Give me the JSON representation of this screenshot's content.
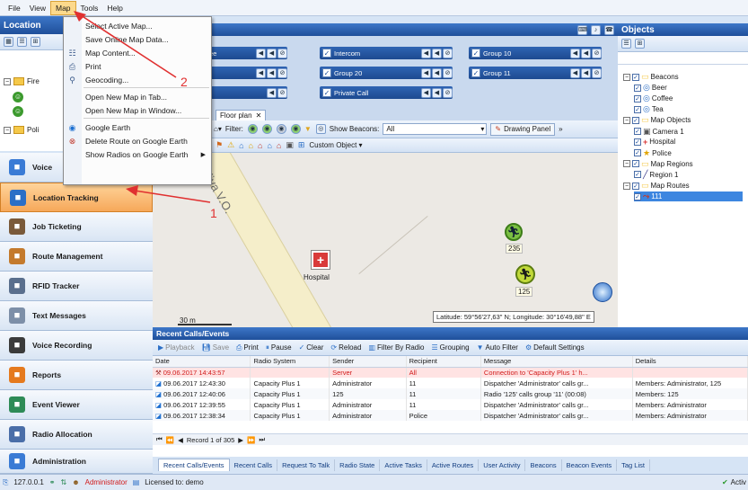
{
  "menubar": [
    "File",
    "View",
    "Map",
    "Tools",
    "Help"
  ],
  "map_menu": [
    {
      "label": "Select Active Map...",
      "icon": ""
    },
    {
      "label": "Save Online Map Data...",
      "icon": ""
    },
    {
      "label": "Map Content...",
      "icon": "list-icon"
    },
    {
      "label": "Print",
      "icon": "printer-icon"
    },
    {
      "label": "Geocoding...",
      "icon": "geocoding-icon"
    },
    {
      "label": "Open New Map in Tab...",
      "icon": ""
    },
    {
      "label": "Open New Map in Window...",
      "icon": ""
    },
    {
      "label": "Google Earth",
      "icon": "google-earth-icon"
    },
    {
      "label": "Delete Route on Google Earth",
      "icon": "delete-route-icon"
    },
    {
      "label": "Show Radios on Google Earth",
      "icon": ""
    }
  ],
  "left_panel": {
    "title": "Location",
    "tree": [
      "Fire",
      "Poli"
    ],
    "nav": [
      {
        "label": "Voice",
        "icon": "voice-dispatch-icon",
        "color": "#3a7bd5"
      },
      {
        "label": "Location Tracking",
        "icon": "location-tracking-icon",
        "color": "#2c6fc6",
        "selected": true
      },
      {
        "label": "Job Ticketing",
        "icon": "job-ticketing-icon",
        "color": "#7a5a3a"
      },
      {
        "label": "Route Management",
        "icon": "route-management-icon",
        "color": "#c47a2c"
      },
      {
        "label": "RFID Tracker",
        "icon": "rfid-icon",
        "color": "#5a6f8d"
      },
      {
        "label": "Text Messages",
        "icon": "text-messages-icon",
        "color": "#7d8fa8"
      },
      {
        "label": "Voice Recording",
        "icon": "voice-recording-icon",
        "color": "#3b3b3b"
      },
      {
        "label": "Reports",
        "icon": "reports-icon",
        "color": "#e57a1e"
      },
      {
        "label": "Event Viewer",
        "icon": "event-viewer-icon",
        "color": "#2e8b57"
      },
      {
        "label": "Radio Allocation",
        "icon": "radio-allocation-icon",
        "color": "#4a6ea8"
      },
      {
        "label": "Administration",
        "icon": "administration-icon",
        "color": "#3a7bd5"
      }
    ]
  },
  "annotations": {
    "arrow1": "1",
    "arrow2": "2"
  },
  "call_groups": {
    "col1": [
      "ee",
      "",
      ""
    ],
    "col2": [
      "Intercom",
      "Group 20",
      "Private Call"
    ],
    "col3": [
      "Group 10",
      "Group 11"
    ]
  },
  "map_tabs": [
    "Floor plan"
  ],
  "map_toolbar": {
    "filter_label": "Filter:",
    "show_beacons_label": "Show Beacons:",
    "show_beacons_value": "All",
    "drawing_panel": "Drawing Panel",
    "custom_object": "Custom Object"
  },
  "map": {
    "street": "liya V.O.",
    "hospital_label": "Hospital",
    "radio1": "235",
    "radio2": "125",
    "scale": "30 m",
    "coords": "Latitude: 59°56'27,63\" N; Longitude: 30°16'49,88\" E"
  },
  "objects_panel": {
    "title": "Objects",
    "tree": [
      {
        "label": "Beacons",
        "level": 0,
        "type": "folder"
      },
      {
        "label": "Beer",
        "level": 1,
        "type": "beacon"
      },
      {
        "label": "Coffee",
        "level": 1,
        "type": "beacon"
      },
      {
        "label": "Tea",
        "level": 1,
        "type": "beacon"
      },
      {
        "label": "Map Objects",
        "level": 0,
        "type": "folder"
      },
      {
        "label": "Camera 1",
        "level": 1,
        "type": "camera"
      },
      {
        "label": "Hospital",
        "level": 1,
        "type": "hospital"
      },
      {
        "label": "Police",
        "level": 1,
        "type": "police"
      },
      {
        "label": "Map Regions",
        "level": 0,
        "type": "folder"
      },
      {
        "label": "Region 1",
        "level": 1,
        "type": "region"
      },
      {
        "label": "Map Routes",
        "level": 0,
        "type": "folder"
      },
      {
        "label": "111",
        "level": 1,
        "type": "route",
        "selected": true
      }
    ]
  },
  "recent_calls": {
    "title": "Recent Calls/Events",
    "toolbar": [
      "Playback",
      "Save",
      "Print",
      "Pause",
      "Clear",
      "Reload",
      "Filter By Radio",
      "Grouping",
      "Auto Filter",
      "Default Settings"
    ],
    "columns": [
      "Date",
      "Radio System",
      "Sender",
      "Recipient",
      "Message",
      "Details"
    ],
    "rows": [
      [
        "09.06.2017 14:43:57",
        "",
        "Server",
        "All",
        "Connection to 'Capacity Plus 1' h...",
        ""
      ],
      [
        "09.06.2017 12:43:30",
        "Capacity Plus 1",
        "Administrator",
        "11",
        "Dispatcher 'Administrator' calls gr...",
        "Members: Administrator, 125"
      ],
      [
        "09.06.2017 12:40:06",
        "Capacity Plus 1",
        "125",
        "11",
        "Radio '125' calls group '11' (00:08)",
        "Members: 125"
      ],
      [
        "09.06.2017 12:39:55",
        "Capacity Plus 1",
        "Administrator",
        "11",
        "Dispatcher 'Administrator' calls gr...",
        "Members: Administrator"
      ],
      [
        "09.06.2017 12:38:34",
        "Capacity Plus 1",
        "Administrator",
        "Police",
        "Dispatcher 'Administrator' calls gr...",
        "Members: Administrator"
      ]
    ],
    "record_text": "Record 1 of 305",
    "tabs": [
      "Recent Calls/Events",
      "Recent Calls",
      "Request To Talk",
      "Radio State",
      "Active Tasks",
      "Active Routes",
      "User Activity",
      "Beacons",
      "Beacon Events",
      "Tag List"
    ]
  },
  "statusbar": {
    "ip": "127.0.0.1",
    "user": "Administrator",
    "license": "Licensed to: demo",
    "right": "Activ"
  },
  "colors": {
    "accent": "#1f4f9a",
    "selection": "#f6a85a",
    "error": "#d11a1a"
  }
}
